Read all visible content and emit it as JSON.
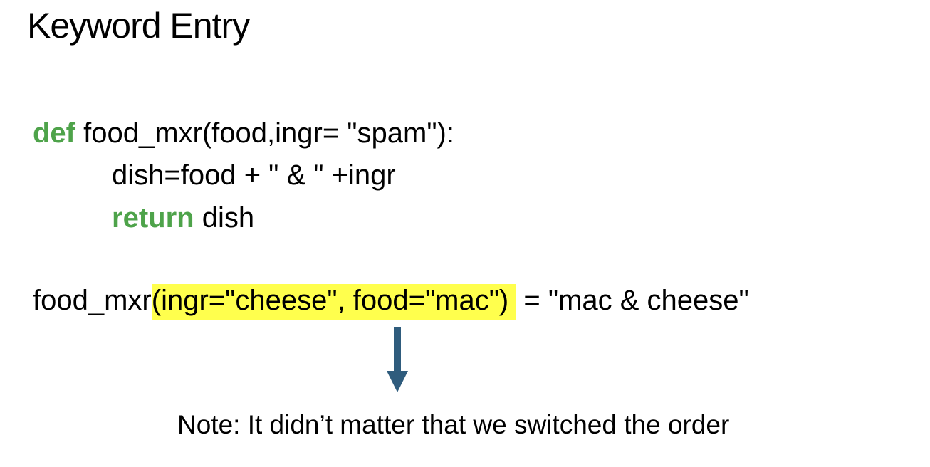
{
  "slide": {
    "title": "Keyword Entry"
  },
  "code": {
    "line1": {
      "keyword": "def",
      "rest": " food_mxr(food,ingr= \"spam\"):"
    },
    "line2": {
      "text": "dish=food + \" & \" +ingr"
    },
    "line3": {
      "keyword": "return",
      "rest": " dish"
    },
    "line4": {
      "prefix": "food_mxr",
      "highlighted": "(ingr=\"cheese\", food=\"mac\")",
      "suffix": " = \"mac & cheese\""
    }
  },
  "note": {
    "text": "Note: It didn’t matter that we switched the order"
  },
  "colors": {
    "keyword": "#4ea34a",
    "highlight": "#ffff4d",
    "arrow": "#2f5c7d"
  }
}
